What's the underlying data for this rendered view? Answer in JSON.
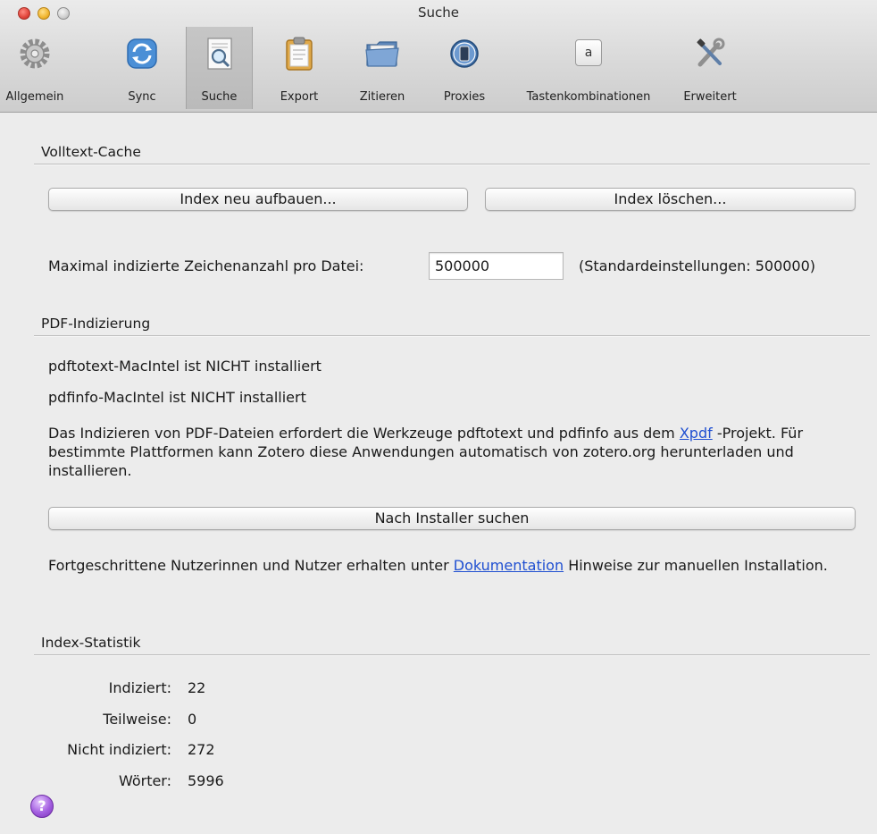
{
  "window": {
    "title": "Suche"
  },
  "toolbar": {
    "items": [
      {
        "label": "Allgemein"
      },
      {
        "label": "Sync"
      },
      {
        "label": "Suche"
      },
      {
        "label": "Export"
      },
      {
        "label": "Zitieren"
      },
      {
        "label": "Proxies"
      },
      {
        "label": "Tastenkombinationen",
        "key_glyph": "a"
      },
      {
        "label": "Erweitert"
      }
    ],
    "active": "Suche"
  },
  "fulltext_cache": {
    "title": "Volltext-Cache",
    "rebuild_button": "Index neu aufbauen...",
    "clear_button": "Index löschen...",
    "max_chars_label": "Maximal indizierte Zeichenanzahl pro Datei:",
    "max_chars_value": "500000",
    "default_note": "(Standardeinstellungen: 500000)"
  },
  "pdf_indexing": {
    "title": "PDF-Indizierung",
    "pdftotext_status": "pdftotext-MacIntel ist NICHT installiert",
    "pdfinfo_status": "pdfinfo-MacIntel ist NICHT installiert",
    "description_before_link": "Das Indizieren von PDF-Dateien erfordert die Werkzeuge pdftotext und pdfinfo aus dem ",
    "xpdf_link": "Xpdf",
    "description_after_link": " -Projekt. Für bestimmte Plattformen kann Zotero diese Anwendungen automatisch von zotero.org herunterladen und installieren.",
    "check_installer_button": "Nach Installer suchen",
    "advanced_before_link": "Fortgeschrittene Nutzerinnen und Nutzer erhalten unter ",
    "documentation_link": "Dokumentation",
    "advanced_after_link": " Hinweise zur manuellen Installation."
  },
  "index_stats": {
    "title": "Index-Statistik",
    "rows": [
      {
        "label": "Indiziert:",
        "value": "22"
      },
      {
        "label": "Teilweise:",
        "value": "0"
      },
      {
        "label": "Nicht indiziert:",
        "value": "272"
      },
      {
        "label": "Wörter:",
        "value": "5996"
      }
    ]
  },
  "help": {
    "glyph": "?"
  },
  "colors": {
    "link": "#1f4fd1",
    "window_bg": "#ececec"
  }
}
